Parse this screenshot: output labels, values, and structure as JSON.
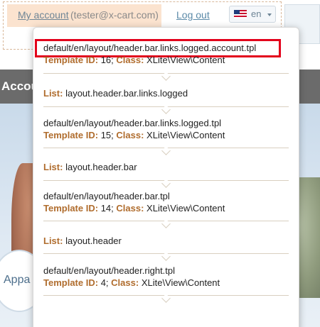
{
  "header": {
    "account_link": "My account",
    "account_email": "(tester@x-cart.com)",
    "logout_link": "Log out",
    "language": "en",
    "flag_icon": "us-flag-icon"
  },
  "page": {
    "section_bar_text": "Accou",
    "round_button_text": "Appa"
  },
  "inspector": {
    "highlight_color": "#e3001b",
    "key_color": "#b06d2e",
    "entries": [
      {
        "path": "default/en/layout/header.bar.links.logged.account.tpl",
        "template_id_label": "Template ID:",
        "template_id": "16",
        "class_label": "Class:",
        "class_value": "XLite\\View\\Content",
        "highlighted": true
      },
      {
        "list_label": "List:",
        "list_value": "layout.header.bar.links.logged"
      },
      {
        "path": "default/en/layout/header.bar.links.logged.tpl",
        "template_id_label": "Template ID:",
        "template_id": "15",
        "class_label": "Class:",
        "class_value": "XLite\\View\\Content"
      },
      {
        "list_label": "List:",
        "list_value": "layout.header.bar"
      },
      {
        "path": "default/en/layout/header.bar.tpl",
        "template_id_label": "Template ID:",
        "template_id": "14",
        "class_label": "Class:",
        "class_value": "XLite\\View\\Content"
      },
      {
        "list_label": "List:",
        "list_value": "layout.header"
      },
      {
        "path": "default/en/layout/header.right.tpl",
        "template_id_label": "Template ID:",
        "template_id": "4",
        "class_label": "Class:",
        "class_value": "XLite\\View\\Content"
      }
    ]
  }
}
